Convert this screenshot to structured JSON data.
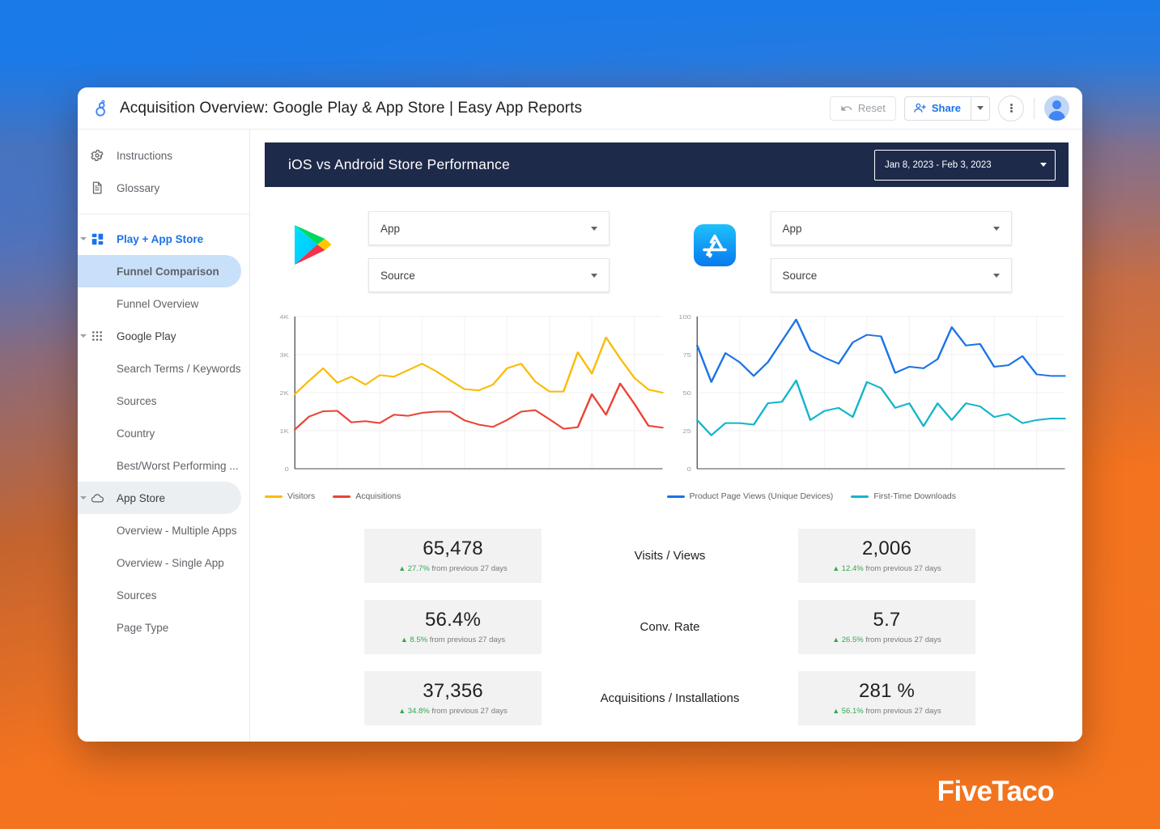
{
  "window": {
    "doc_title": "Acquisition Overview: Google Play & App Store  | Easy App Reports",
    "logo_icon": "datastudio-logo-icon"
  },
  "toolbar": {
    "reset_label": "Reset",
    "reset_icon": "undo-icon",
    "share_label": "Share",
    "share_icon": "person-add-icon",
    "share_caret_icon": "chevron-down-icon",
    "more_icon": "kebab-menu-icon",
    "avatar_icon": "user-avatar-icon"
  },
  "sidebar": {
    "items": [
      {
        "label": "Instructions",
        "icon": "gear-icon",
        "type": "plain",
        "state": "normal"
      },
      {
        "label": "Glossary",
        "icon": "document-icon",
        "type": "plain",
        "state": "normal"
      },
      {
        "label": "Play + App Store",
        "icon": "dashboard-grid-icon",
        "type": "group",
        "state": "expanded"
      },
      {
        "label": "Funnel Comparison",
        "icon": "",
        "type": "child",
        "state": "active"
      },
      {
        "label": "Funnel Overview",
        "icon": "",
        "type": "child",
        "state": "normal"
      },
      {
        "label": "Google Play",
        "icon": "apps-dots-icon",
        "type": "group-plain",
        "state": "expanded"
      },
      {
        "label": "Search Terms / Keywords",
        "icon": "",
        "type": "child",
        "state": "normal"
      },
      {
        "label": "Sources",
        "icon": "",
        "type": "child",
        "state": "normal"
      },
      {
        "label": "Country",
        "icon": "",
        "type": "child",
        "state": "normal"
      },
      {
        "label": "Best/Worst Performing ...",
        "icon": "",
        "type": "child",
        "state": "normal"
      },
      {
        "label": "App Store",
        "icon": "cloud-icon",
        "type": "group-plain",
        "state": "expanded-shaded"
      },
      {
        "label": "Overview - Multiple Apps",
        "icon": "",
        "type": "child",
        "state": "normal"
      },
      {
        "label": "Overview - Single App",
        "icon": "",
        "type": "child",
        "state": "normal"
      },
      {
        "label": "Sources",
        "icon": "",
        "type": "child",
        "state": "normal"
      },
      {
        "label": "Page Type",
        "icon": "",
        "type": "child",
        "state": "normal"
      }
    ]
  },
  "report": {
    "title": "iOS vs Android Store Performance",
    "date_range": "Jan 8, 2023 - Feb 3, 2023",
    "date_range_caret_icon": "chevron-down-icon",
    "header_bg": "#1e2a4a"
  },
  "stores": {
    "google_play": {
      "logo_icon": "google-play-icon",
      "app_filter": "App",
      "source_filter": "Source"
    },
    "app_store": {
      "logo_icon": "app-store-icon",
      "app_filter": "App",
      "source_filter": "Source"
    }
  },
  "chart_data": [
    {
      "type": "line",
      "id": "google-play-trend",
      "title": "",
      "xlabel": "",
      "ylabel": "",
      "ylim": [
        0,
        4000
      ],
      "yticks": [
        0,
        1000,
        2000,
        3000,
        4000
      ],
      "ytick_labels": [
        "0",
        "1K",
        "2K",
        "3K",
        "4K"
      ],
      "grid": true,
      "legend_position": "bottom-left",
      "x": [
        1,
        2,
        3,
        4,
        5,
        6,
        7,
        8,
        9,
        10,
        11,
        12,
        13,
        14,
        15,
        16,
        17,
        18,
        19,
        20,
        21,
        22,
        23,
        24,
        25,
        26,
        27
      ],
      "series": [
        {
          "name": "Visitors",
          "color": "#fbbc04",
          "values": [
            1960,
            2310,
            2640,
            2260,
            2420,
            2210,
            2460,
            2420,
            2590,
            2760,
            2560,
            2320,
            2090,
            2060,
            2210,
            2640,
            2760,
            2290,
            2030,
            2030,
            3060,
            2500,
            3450,
            2900,
            2390,
            2080,
            2000
          ]
        },
        {
          "name": "Acquisitions",
          "color": "#ea4335",
          "values": [
            1030,
            1370,
            1510,
            1520,
            1220,
            1250,
            1200,
            1420,
            1390,
            1470,
            1500,
            1500,
            1270,
            1160,
            1100,
            1280,
            1500,
            1540,
            1300,
            1050,
            1090,
            1960,
            1420,
            2240,
            1710,
            1130,
            1080
          ]
        }
      ]
    },
    {
      "type": "line",
      "id": "app-store-trend",
      "title": "",
      "xlabel": "",
      "ylabel": "",
      "ylim": [
        0,
        100
      ],
      "yticks": [
        0,
        25,
        50,
        75,
        100
      ],
      "ytick_labels": [
        "0",
        "25",
        "50",
        "75",
        "100"
      ],
      "grid": true,
      "legend_position": "bottom-left",
      "x": [
        1,
        2,
        3,
        4,
        5,
        6,
        7,
        8,
        9,
        10,
        11,
        12,
        13,
        14,
        15,
        16,
        17,
        18,
        19,
        20,
        21,
        22,
        23,
        24,
        25,
        26,
        27
      ],
      "series": [
        {
          "name": "Product Page Views (Unique Devices)",
          "color": "#1a73e8",
          "values": [
            81,
            57,
            76,
            70,
            61,
            70,
            84,
            98,
            78,
            73,
            69,
            83,
            88,
            87,
            63,
            67,
            66,
            72,
            93,
            81,
            82,
            67,
            68,
            74,
            62,
            61,
            61
          ]
        },
        {
          "name": "First-Time Downloads",
          "color": "#12b5cb",
          "values": [
            32,
            22,
            30,
            30,
            29,
            43,
            44,
            58,
            32,
            38,
            40,
            34,
            57,
            53,
            40,
            43,
            28,
            43,
            32,
            43,
            41,
            34,
            36,
            30,
            32,
            33,
            33
          ]
        }
      ]
    }
  ],
  "scorecards": [
    {
      "label": "Visits / Views",
      "left": {
        "value": "65,478",
        "delta": "27.7%",
        "delta_suffix": "from previous 27 days",
        "direction": "up"
      },
      "right": {
        "value": "2,006",
        "delta": "12.4%",
        "delta_suffix": "from previous 27 days",
        "direction": "up"
      }
    },
    {
      "label": "Conv. Rate",
      "left": {
        "value": "56.4%",
        "delta": "8.5%",
        "delta_suffix": "from previous 27 days",
        "direction": "up"
      },
      "right": {
        "value": "5.7",
        "delta": "26.5%",
        "delta_suffix": "from previous 27 days",
        "direction": "up"
      }
    },
    {
      "label": "Acquisitions / Installations",
      "left": {
        "value": "37,356",
        "delta": "34.8%",
        "delta_suffix": "from previous 27 days",
        "direction": "up"
      },
      "right": {
        "value": "281 %",
        "delta": "56.1%",
        "delta_suffix": "from previous 27 days",
        "direction": "up"
      }
    }
  ],
  "watermark": {
    "text": "FiveTaco"
  },
  "colors": {
    "accent_blue": "#1a73e8",
    "positive_green": "#34a853",
    "header_navy": "#1e2a4a",
    "card_bg": "#f2f2f2"
  }
}
